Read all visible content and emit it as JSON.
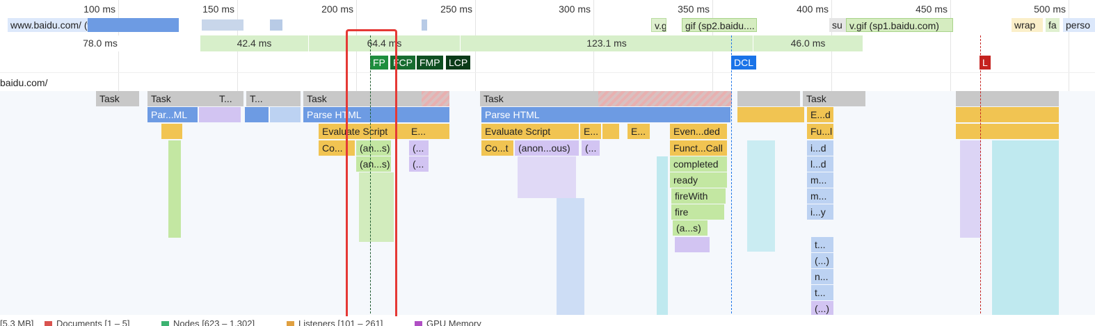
{
  "ruler": {
    "ticks": [
      "100 ms",
      "150 ms",
      "200 ms",
      "250 ms",
      "300 ms",
      "350 ms",
      "400 ms",
      "450 ms",
      "500 ms"
    ]
  },
  "network": {
    "doc": "www.baidu.com/ (www.baidu.com)",
    "gif1": "v.g",
    "gif2": "gif (sp2.baidu....",
    "su": "su",
    "gif3": "v.gif (sp1.baidu.com)",
    "wrap": "wrap",
    "fa": "fa",
    "perso": "perso"
  },
  "segments": [
    "78.0 ms",
    "42.4 ms",
    "64.4 ms",
    "123.1 ms",
    "46.0 ms"
  ],
  "markers": {
    "fp": "FP",
    "fcp": "FCP",
    "fmp": "FMP",
    "lcp": "LCP",
    "dcl": "DCL",
    "l": "L"
  },
  "main_thread": {
    "url": "baidu.com/",
    "task": "Task",
    "task_t": "T...",
    "parse_ml": "Par...ML",
    "parse_html": "Parse HTML",
    "evaluate_script": "Evaluate Script",
    "e_short": "E...",
    "compile": "Co...",
    "compile_t": "Co...t",
    "anon_s": "(an...s)",
    "anon_short": "(...",
    "anon_ous": "(anon...ous)",
    "event_ded": "Even...ded",
    "funct_call": "Funct...Call",
    "completed": "completed",
    "ready": "ready",
    "fire_with": "fireWith",
    "fire": "fire",
    "a_s": "(a...s)",
    "e_d": "E...d",
    "fu_l": "Fu...l",
    "i_d": "i...d",
    "l_d": "l...d",
    "m_1": "m...",
    "m_2": "m...",
    "i_y": "i...y",
    "t_1": "t...",
    "paren": "(...)",
    "n_1": "n...",
    "t_2": "t...",
    "paren2": "(...)"
  },
  "status_bar": {
    "js_heap": "[5.3 MB]",
    "documents": "Documents [1 – 5]",
    "nodes": "Nodes [623 – 1,302]",
    "listeners": "Listeners [101 – 261]",
    "gpu": "GPU Memory"
  },
  "colors": {
    "task": "#c8c8c8",
    "parse": "#6d9be3",
    "script": "#f1c452",
    "function": "#c3e7a2",
    "fp": "#1e8e3e",
    "fcp": "#176c30",
    "fmp": "#0f4f22",
    "lcp": "#0b3a18",
    "dcl": "#1a73e8",
    "load": "#c5221f",
    "highlight": "#e53935"
  }
}
